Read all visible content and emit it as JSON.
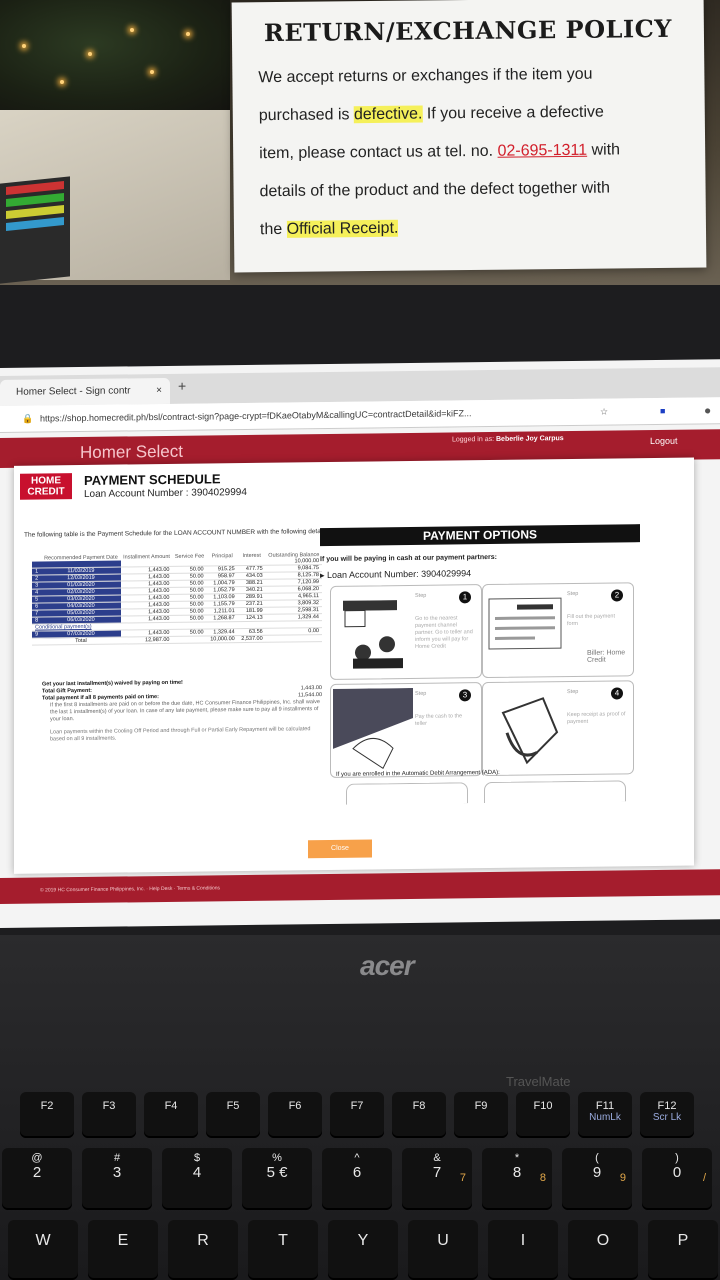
{
  "sign": {
    "title": "RETURN/EXCHANGE POLICY",
    "line1": "We accept returns or exchanges if the item you",
    "line2_a": "purchased is ",
    "line2_hl": "defective.",
    "line2_b": " If you receive a defective",
    "line3_a": "item, please contact us at tel. no. ",
    "phone": "02-695-1311",
    "line3_b": " with",
    "line4": "details of the product and the defect together with",
    "line5_a": "the ",
    "line5_hl": "Official Receipt."
  },
  "browser": {
    "tab_title": "Homer Select - Sign contr",
    "tab_close": "×",
    "new_tab": "+",
    "url": "https://shop.homecredit.ph/bsl/contract-sign?page-crypt=fDKaeOtabyM&callingUC=contractDetail&id=kiFZ...",
    "star": "☆"
  },
  "site": {
    "brand": "Homer Select",
    "logged_in_label": "Logged in as:",
    "user": "Beberlie Joy Carpus",
    "logout": "Logout"
  },
  "schedule": {
    "logo_line1": "HOME",
    "logo_line2": "CREDIT",
    "title": "PAYMENT SCHEDULE",
    "loan_label": "Loan Account Number : 3904029994",
    "intro": "The following table is the Payment Schedule for the LOAN ACCOUNT NUMBER with the following details:",
    "headers": [
      "",
      "Recommended Payment Date",
      "Installment Amount",
      "Service Fee",
      "Principal",
      "Interest",
      "Outstanding Balance"
    ],
    "opening_balance": "10,000.00",
    "rows": [
      [
        "1",
        "11/03/2019",
        "1,443.00",
        "50.00",
        "915.25",
        "477.75",
        "9,084.75"
      ],
      [
        "2",
        "12/03/2019",
        "1,443.00",
        "50.00",
        "958.97",
        "434.03",
        "8,125.78"
      ],
      [
        "3",
        "01/03/2020",
        "1,443.00",
        "50.00",
        "1,004.79",
        "388.21",
        "7,120.99"
      ],
      [
        "4",
        "02/03/2020",
        "1,443.00",
        "50.00",
        "1,052.79",
        "340.21",
        "6,068.20"
      ],
      [
        "5",
        "03/03/2020",
        "1,443.00",
        "50.00",
        "1,103.09",
        "289.91",
        "4,965.11"
      ],
      [
        "6",
        "04/03/2020",
        "1,443.00",
        "50.00",
        "1,155.79",
        "237.21",
        "3,809.32"
      ],
      [
        "7",
        "05/03/2020",
        "1,443.00",
        "50.00",
        "1,211.01",
        "181.99",
        "2,598.31"
      ],
      [
        "8",
        "06/03/2020",
        "1,443.00",
        "50.00",
        "1,268.87",
        "124.13",
        "1,329.44"
      ]
    ],
    "conditional_label": "Conditional payment(s)",
    "conditional_row": [
      "9",
      "07/03/2020",
      "1,443.00",
      "50.00",
      "1,329.44",
      "63.56",
      "0.00"
    ],
    "total_label": "Total",
    "total_amount": "12,987.00",
    "total_principal": "10,000.00",
    "total_interest": "2,537.00",
    "waived_note": "Get your last installment(s) waived by paying on time!",
    "gift_label": "Total Gift Payment:",
    "gift_value": "1,443.00",
    "ontime_label": "Total payment if all 8 payments paid on time:",
    "ontime_value": "11,544.00",
    "fine_print": "If the first 8 installments are paid on or before the due date, HC Consumer Finance Philippines, Inc. shall waive the last 1 installment(s) of your loan. In case of any late payment, please make sure to pay all 9 installments of your loan.",
    "cooling_note": "Loan payments within the Cooling Off Period and through Full or Partial Early Repayment will be calculated based on all 9 installments."
  },
  "payment_options": {
    "heading": "PAYMENT OPTIONS",
    "cash_line": "If you will be paying in cash at our payment partners:",
    "loan_line": "Loan Account Number: 3904029994",
    "steps": [
      {
        "label": "Step",
        "num": "1",
        "desc": "Go to the nearest payment channel partner. Go to teller and inform you will pay for Home Credit"
      },
      {
        "label": "Step",
        "num": "2",
        "desc": "Fill out the payment form",
        "biller": "Biller: Home Credit"
      },
      {
        "label": "Step",
        "num": "3",
        "desc": "Pay the cash to the teller"
      },
      {
        "label": "Step",
        "num": "4",
        "desc": "Keep receipt as proof of payment"
      }
    ],
    "ada_line": "If you are enrolled in the Automatic Debit Arrangement (ADA):",
    "close_label": "Close"
  },
  "footer": {
    "text": "© 2019 HC Consumer Finance Philippines, Inc. · Help Desk · Terms & Conditions"
  },
  "laptop": {
    "brand": "acer",
    "model": "TravelMate",
    "fkeys": [
      "F2",
      "F3",
      "F4",
      "F5",
      "F6",
      "F7",
      "F8",
      "F9",
      "F10",
      "F11",
      "F12"
    ],
    "fkeys_sub": [
      "",
      "",
      "",
      "",
      "",
      "",
      "",
      "",
      "",
      "NumLk",
      "Scr Lk"
    ],
    "num_top": [
      "@",
      "#",
      "$",
      "%",
      "^",
      "&",
      "*",
      "(",
      ")"
    ],
    "num_main": [
      "2",
      "3",
      "4",
      "5 €",
      "6",
      "7",
      "8",
      "9",
      "0"
    ],
    "num_alt": [
      "",
      "",
      "",
      "",
      "",
      "7",
      "8",
      "9",
      "/"
    ],
    "letters": [
      "W",
      "E",
      "R",
      "T",
      "Y",
      "U",
      "I",
      "O",
      "P"
    ]
  }
}
